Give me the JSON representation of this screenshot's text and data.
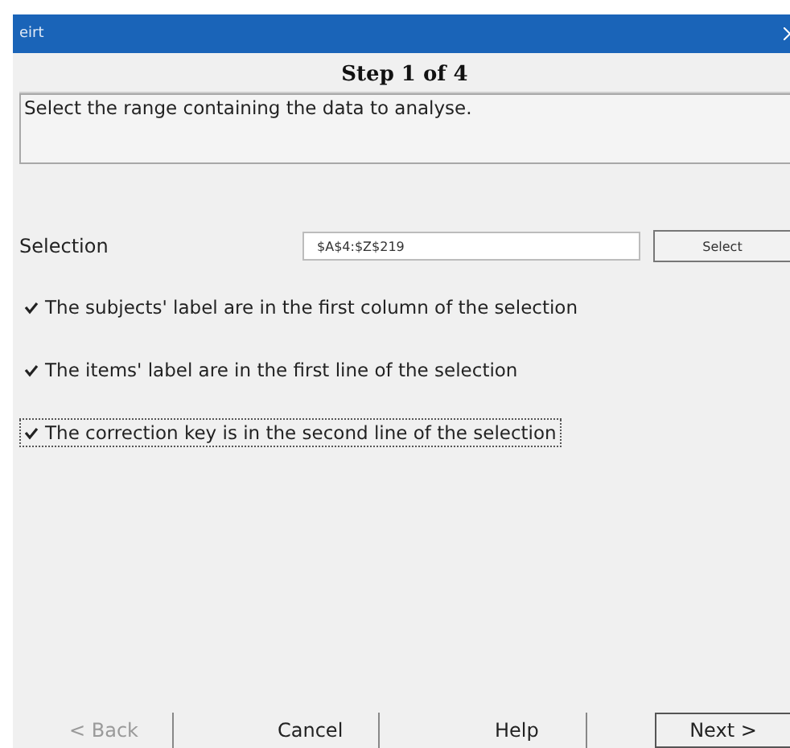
{
  "window": {
    "title": "eirt"
  },
  "step_title": "Step 1 of 4",
  "instructions": "Select the range containing the data to analyse.",
  "selection": {
    "label": "Selection",
    "value": "$A$4:$Z$219",
    "button": "Select"
  },
  "options": [
    {
      "label": "The subjects' label are in the first column of the selection",
      "checked": true,
      "focused": false
    },
    {
      "label": "The items' label are in the first line of the selection",
      "checked": true,
      "focused": false
    },
    {
      "label": "The correction key is in the second line of the selection",
      "checked": true,
      "focused": true
    }
  ],
  "buttons": [
    {
      "label": "< Back",
      "disabled": true,
      "default": false
    },
    {
      "label": "Cancel",
      "disabled": false,
      "default": false
    },
    {
      "label": "Help",
      "disabled": false,
      "default": false
    },
    {
      "label": "Next >",
      "disabled": false,
      "default": true
    }
  ]
}
